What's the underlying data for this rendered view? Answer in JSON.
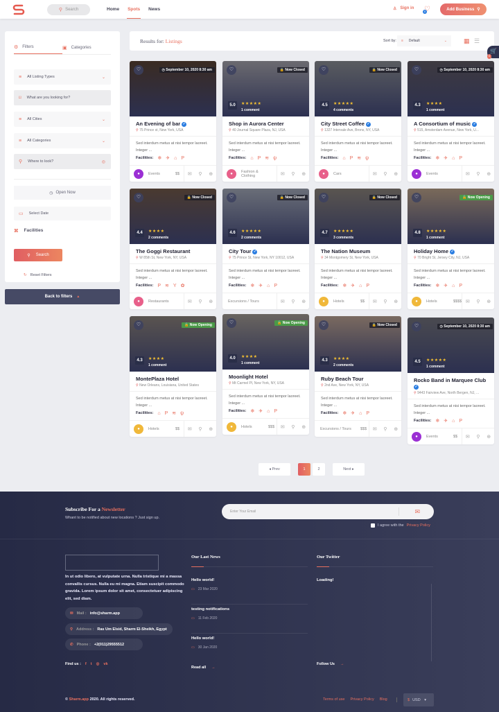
{
  "header": {
    "logo": "S",
    "search_placeholder": "Search",
    "nav": [
      {
        "label": "Home"
      },
      {
        "label": "Spots",
        "active": true
      },
      {
        "label": "News"
      }
    ],
    "sign_in": "Sign in",
    "favorites_count": "0",
    "add_business": "Add Business"
  },
  "sidebar": {
    "tabs": [
      {
        "label": "Filters",
        "active": true
      },
      {
        "label": "Categories"
      }
    ],
    "listing_types": "All Listing Types",
    "keyword_placeholder": "What are you looking for?",
    "cities": "All Cities",
    "categories": "All Categories",
    "location_placeholder": "Where to look?",
    "open_now": "Open Now",
    "date_placeholder": "Select Date",
    "facilities": "Facilities",
    "search_button": "Search",
    "reset": "Reset Filters",
    "back_to_filters": "Back to filters"
  },
  "results": {
    "label": "Results for:",
    "query": "Listings",
    "sort_label": "Sort by:",
    "sort_value": "Default",
    "cart_count": "0"
  },
  "listings": [
    {
      "name": "An Evening of bar",
      "verified": true,
      "address": "75 Prince st, New York, USA",
      "tag": "September 10, 2020 8:30 am",
      "tag_type": "event",
      "rating": "",
      "stars": 0,
      "comments": "",
      "desc": "Sed interdum metus at nisi tempor laoreet. Integer ...",
      "facilities_label": "Facilities:",
      "facilities": [
        "❄",
        "✈",
        "⌂",
        "P"
      ],
      "category": "Events",
      "cat_color": "#9b2fd4",
      "price": "$$",
      "img": "#3a2b22"
    },
    {
      "name": "Shop in Aurora Center",
      "verified": false,
      "address": "40 Journal Square Plaza, NJ, USA",
      "tag": "Now Closed",
      "tag_type": "closed",
      "rating": "5.0",
      "stars": 5,
      "comments": "1 comment",
      "desc": "Sed interdum metus at nisi tempor laoreet. Integer ...",
      "facilities_label": "Facilities:",
      "facilities": [
        "⌂",
        "P",
        "≋",
        "ψ"
      ],
      "category": "Fashion & Clothing",
      "cat_color": "#e8608a",
      "price": "",
      "img": "#6b6a70"
    },
    {
      "name": "City Street Coffee",
      "verified": true,
      "address": "1327 Intervale Ave, Bronx, NY, USA",
      "tag": "Now Closed",
      "tag_type": "closed",
      "rating": "4.5",
      "stars": 5,
      "comments": "4 comments",
      "desc": "Sed interdum metus at nisi tempor laoreet. Integer ...",
      "facilities_label": "Facilities:",
      "facilities": [
        "⌂",
        "P",
        "≋",
        "ψ"
      ],
      "category": "Cars",
      "cat_color": "#e8608a",
      "price": "",
      "img": "#5a5c60"
    },
    {
      "name": "A Consortium of music",
      "verified": true,
      "address": "515, Amsterdam Avenue, New York, U...",
      "tag": "September 10, 2020 8:30 am",
      "tag_type": "event",
      "rating": "4.3",
      "stars": 4,
      "comments": "1 comment",
      "desc": "Sed interdum metus at nisi tempor laoreet. Integer ...",
      "facilities_label": "Facilities:",
      "facilities": [
        "❄",
        "✈",
        "⌂",
        "P"
      ],
      "category": "Events",
      "cat_color": "#9b2fd4",
      "price": "",
      "img": "#3e3a40"
    },
    {
      "name": "The Goggi Restaurant",
      "verified": false,
      "address": "W 85th St, New York, NY, USA",
      "tag": "Now Closed",
      "tag_type": "closed",
      "rating": "4.4",
      "stars": 4,
      "comments": "2 comments",
      "desc": "Sed interdum metus at nisi tempor laoreet. Integer ...",
      "facilities_label": "Facilities:",
      "facilities": [
        "P",
        "≋",
        "Y",
        "✿"
      ],
      "category": "Restaurants",
      "cat_color": "#e8608a",
      "price": "",
      "img": "#4a3a30"
    },
    {
      "name": "City Tour",
      "verified": true,
      "address": "75 Prince St, New York, NY 10012, USA",
      "tag": "Now Closed",
      "tag_type": "closed",
      "rating": "4.6",
      "stars": 5,
      "comments": "2 comments",
      "desc": "Sed interdum metus at nisi tempor laoreet. Integer ...",
      "facilities_label": "Facilities:",
      "facilities": [
        "❄",
        "✈",
        "⌂",
        "P"
      ],
      "category": "Excursions / Tours",
      "cat_color": "",
      "price": "",
      "img": "#6a6e78"
    },
    {
      "name": "The Nation Museum",
      "verified": false,
      "address": "34 Montgomery St, New York, USA",
      "tag": "Now Closed",
      "tag_type": "closed",
      "rating": "4.7",
      "stars": 5,
      "comments": "3 comments",
      "desc": "Sed interdum metus at nisi tempor laoreet. Integer ...",
      "facilities_label": "Facilities:",
      "facilities": [
        "❄",
        "✈",
        "⌂",
        "P"
      ],
      "category": "Hotels",
      "cat_color": "#f0b83a",
      "price": "$$",
      "img": "#5a5550"
    },
    {
      "name": "Holiday Home",
      "verified": true,
      "address": "70 Bright St, Jersey City, NJ, USA",
      "tag": "Now Opening",
      "tag_type": "open",
      "rating": "4.8",
      "stars": 5,
      "comments": "1 comment",
      "desc": "Sed interdum metus at nisi tempor laoreet. Integer ...",
      "facilities_label": "Facilities:",
      "facilities": [
        "❄",
        "✈",
        "⌂",
        "P"
      ],
      "category": "Hotels",
      "cat_color": "#f0b83a",
      "price": "$$$$",
      "img": "#7a6a5a"
    },
    {
      "name": "MontePlaza Hotel",
      "verified": false,
      "address": "New Orleans, Louisiana, United States",
      "tag": "Now Opening",
      "tag_type": "open",
      "rating": "4.3",
      "stars": 4,
      "comments": "1 comment",
      "desc": "Sed interdum metus at nisi tempor laoreet. Integer ...",
      "facilities_label": "Facilities:",
      "facilities": [
        "⌂",
        "P",
        "≋",
        "ψ"
      ],
      "category": "Hotels",
      "cat_color": "#f0b83a",
      "price": "$$",
      "img": "#5a5450"
    },
    {
      "name": "Moonlight Hotel",
      "verified": false,
      "address": "Mt Carmel Pl, New York, NY, USA",
      "tag": "Now Opening",
      "tag_type": "open",
      "rating": "4.0",
      "stars": 4,
      "comments": "1 comment",
      "desc": "Sed interdum metus at nisi tempor laoreet. Integer ...",
      "facilities_label": "Facilities:",
      "facilities": [
        "❄",
        "✈",
        "⌂",
        "P"
      ],
      "category": "Hotels",
      "cat_color": "#f0b83a",
      "price": "$$$",
      "img": "#6a6560"
    },
    {
      "name": "Ruby Beach Tour",
      "verified": false,
      "address": "2nd Ave, New York, NY, USA",
      "tag": "Now Closed",
      "tag_type": "closed",
      "rating": "4.3",
      "stars": 4,
      "comments": "2 comments",
      "desc": "Sed interdum metus at nisi tempor laoreet. Integer ...",
      "facilities_label": "Facilities:",
      "facilities": [
        "❄",
        "✈",
        "⌂",
        "P"
      ],
      "category": "Excursions / Tours",
      "cat_color": "",
      "price": "$$$",
      "img": "#7a6a60"
    },
    {
      "name": "Rocko Band in Marquee Club",
      "verified": true,
      "address": "9443 Fairview Ave, North Bergen, NJ, ...",
      "tag": "September 10, 2020 8:30 am",
      "tag_type": "event",
      "rating": "4.5",
      "stars": 5,
      "comments": "1 comment",
      "desc": "Sed interdum metus at nisi tempor laoreet. Integer ...",
      "facilities_label": "Facilities:",
      "facilities": [
        "❄",
        "✈",
        "⌂",
        "P"
      ],
      "category": "Events",
      "cat_color": "#9b2fd4",
      "price": "$$",
      "img": "#4a4a50"
    }
  ],
  "pagination": {
    "prev": "Prev",
    "pages": [
      "1",
      "2"
    ],
    "current": "1",
    "next": "Next"
  },
  "footer": {
    "newsletter_title": "Subscribe For a",
    "newsletter_highlight": "Newsletter",
    "newsletter_sub": "Whant to be notified about new locations ? Just sign up.",
    "email_placeholder": "Enter Your Email",
    "agree_text": "I agree with the",
    "privacy_link": "Privacy Policy",
    "about": "In ut odio libero, at vulputate urna. Nulla tristique mi a massa convallis cursus. Nulla eu mi magna. Etiam suscipit commodo gravida. Lorem ipsum dolor sit amet, consectetuer adipiscing elit, sed diam.",
    "mail_label": "Mail :",
    "mail": "info@sharm.app",
    "address_label": "Address :",
    "address": "Ras Um Elsid, Sharm El-Sheikh, Egypt",
    "phone_label": "Phone :",
    "phone": "+2(011)29555512",
    "find_us": "Find us :",
    "news_title": "Our Last News",
    "news": [
      {
        "title": "Hello world!",
        "date": "23 Mar 2020"
      },
      {
        "title": "testing notifications",
        "date": "11 Feb 2020"
      },
      {
        "title": "Hello world!",
        "date": "30 Jan 2020"
      }
    ],
    "read_all": "Read all",
    "twitter_title": "Our Twitter",
    "twitter_loading": "Loading!",
    "follow_us": "Follow Us",
    "copyright_pre": "©",
    "copyright_brand": "Sharm.app",
    "copyright_post": "2020. All rights reserved.",
    "links": [
      "Terms of use",
      "Privacy Policy",
      "Blog"
    ],
    "currency": "USD"
  }
}
